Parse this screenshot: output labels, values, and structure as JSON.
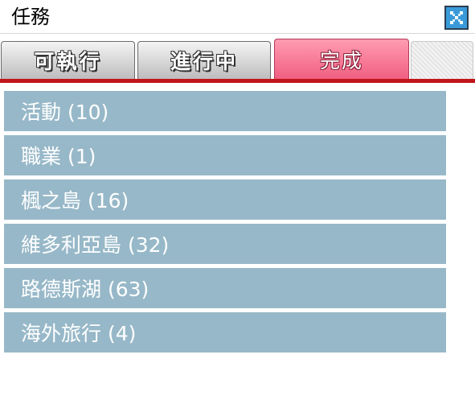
{
  "window": {
    "title": "任務"
  },
  "tabs": [
    {
      "label": "可執行"
    },
    {
      "label": "進行中"
    },
    {
      "label": "完成",
      "active": true
    }
  ],
  "categories": [
    {
      "label": "活動 (10)"
    },
    {
      "label": "職業 (1)"
    },
    {
      "label": "楓之島 (16)"
    },
    {
      "label": "維多利亞島 (32)"
    },
    {
      "label": "路德斯湖 (63)"
    },
    {
      "label": "海外旅行 (4)"
    }
  ],
  "colors": {
    "accent_tab": "#f05f82",
    "divider": "#c0161b",
    "list_item": "#97b8c8",
    "close_button": "#3a9ad9"
  },
  "icons": {
    "close": "close-icon"
  }
}
